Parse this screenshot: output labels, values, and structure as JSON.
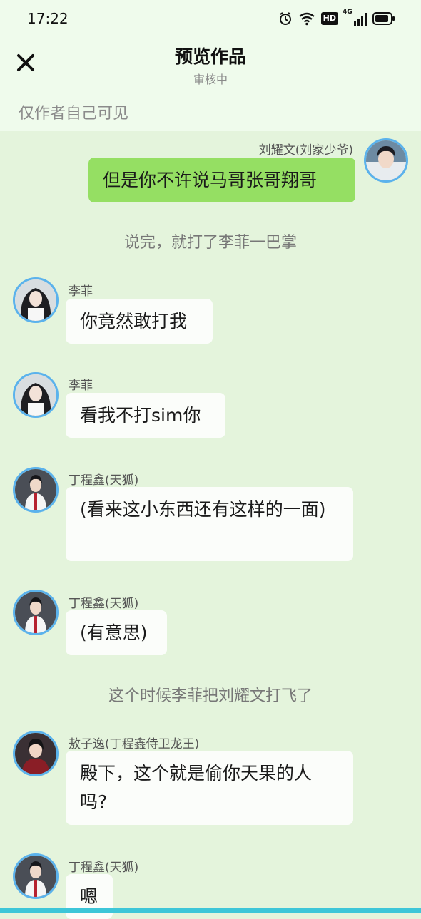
{
  "status": {
    "time": "17:22",
    "hd": "HD",
    "network": "4G"
  },
  "header": {
    "title": "预览作品",
    "subtitle": "审核中"
  },
  "visibility_note": "仅作者自己可见",
  "messages": [
    {
      "sender": "刘耀文(刘家少爷)",
      "text": "但是你不许说马哥张哥翔哥"
    },
    {
      "narration": "说完，就打了李菲一巴掌"
    },
    {
      "sender": "李菲",
      "text": "你竟然敢打我"
    },
    {
      "sender": "李菲",
      "text": "看我不打sim你"
    },
    {
      "sender": "丁程鑫(天狐)",
      "text": "(看来这小东西还有这样的一面)"
    },
    {
      "sender": "丁程鑫(天狐)",
      "text": "(有意思)"
    },
    {
      "narration": "这个时候李菲把刘耀文打飞了"
    },
    {
      "sender": "敖子逸(丁程鑫侍卫龙王)",
      "text": "殿下，这个就是偷你天果的人吗?"
    },
    {
      "sender": "丁程鑫(天狐)",
      "text": "嗯"
    }
  ],
  "colors": {
    "accent": "#5bb2ec",
    "my_bubble": "#95df63",
    "background": "#e4f4dc"
  }
}
